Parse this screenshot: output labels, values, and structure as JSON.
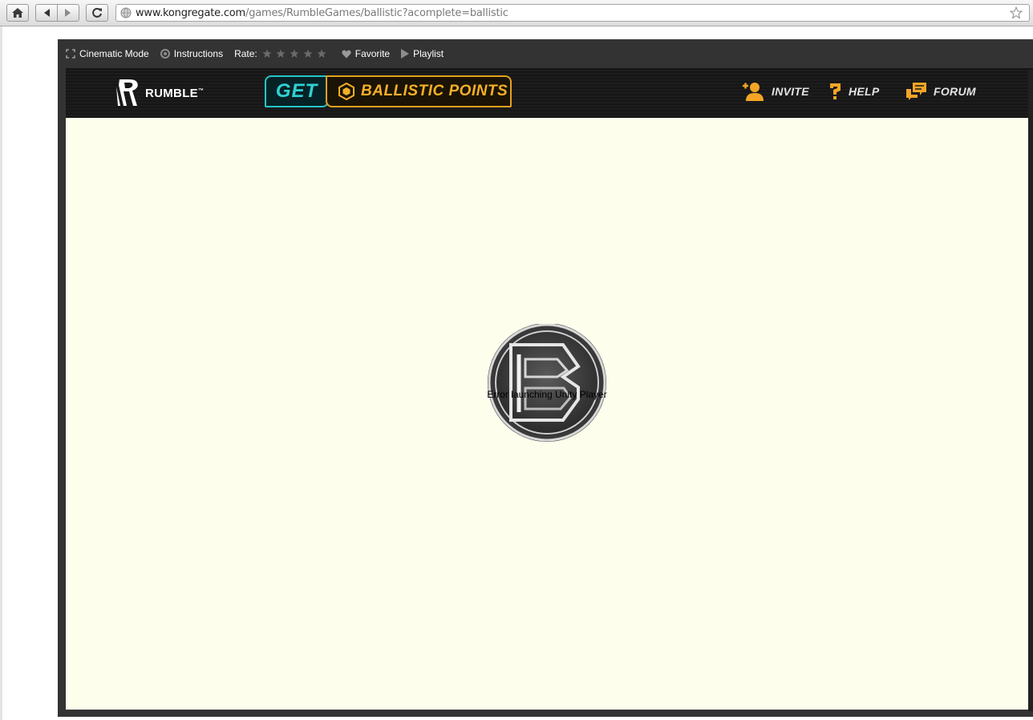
{
  "browser": {
    "url_host": "www.kongregate.com",
    "url_path": "/games/RumbleGames/ballistic?acomplete=ballistic"
  },
  "game_toolbar": {
    "cinematic_label": "Cinematic Mode",
    "instructions_label": "Instructions",
    "rate_label": "Rate:",
    "rating_stars": 0,
    "favorite_label": "Favorite",
    "playlist_label": "Playlist"
  },
  "game_header": {
    "brand": "RUMBLE",
    "brand_tm": "™",
    "get_label": "GET",
    "points_label": "BALLISTIC POINTS",
    "invite_label": "INVITE",
    "help_label": "HELP",
    "forum_label": "FORUM"
  },
  "game": {
    "error_message": "Error launching Unity Player"
  },
  "colors": {
    "game_background": "#fefeec",
    "accent_cyan": "#2fd1d4",
    "accent_gold": "#f4b027",
    "frame": "#333333"
  }
}
